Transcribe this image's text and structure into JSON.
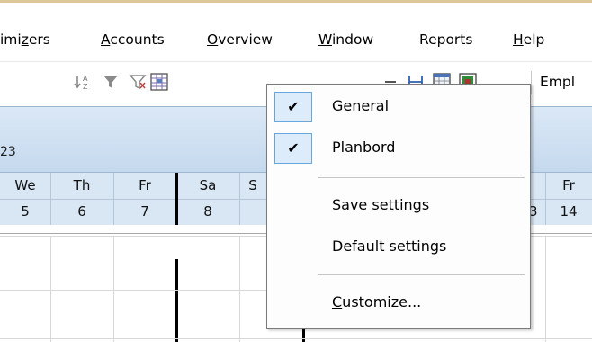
{
  "menubar": {
    "items": [
      {
        "pre": "imi",
        "u": "z",
        "post": "ers"
      },
      {
        "pre": "",
        "u": "A",
        "post": "ccounts"
      },
      {
        "pre": "",
        "u": "O",
        "post": "verview"
      },
      {
        "pre": "",
        "u": "W",
        "post": "indow"
      },
      {
        "pre": "Reports",
        "u": "",
        "post": ""
      },
      {
        "pre": "",
        "u": "H",
        "post": "elp"
      }
    ]
  },
  "toolbar": {
    "icons": [
      "sort-za-icon",
      "filter-icon",
      "filter-clear-icon",
      "layout-grid-icon",
      "minus-icon",
      "split-view-icon",
      "calendar-icon",
      "color-grid-icon"
    ],
    "employee_label": "Empl"
  },
  "dateband": {
    "label": "23"
  },
  "days": {
    "names": [
      "We",
      "Th",
      "Fr",
      "Sa",
      "S",
      "",
      "Fr"
    ],
    "numbers": [
      "5",
      "6",
      "7",
      "8",
      "",
      "3",
      "14"
    ]
  },
  "context_menu": {
    "items": [
      {
        "label": "General",
        "checked": true,
        "check_glyph": "✔"
      },
      {
        "label": "Planbord",
        "checked": true,
        "check_glyph": "✔"
      },
      {
        "label": "Save settings",
        "checked": false
      },
      {
        "label": "Default settings",
        "checked": false
      },
      {
        "label_u": "C",
        "label_rest": "ustomize...",
        "checked": false
      }
    ]
  },
  "colors": {
    "menu_border": "#7a7a7a",
    "check_bg": "#dcecfb",
    "check_border": "#67a7e0",
    "header_bg": "#d9e6f3",
    "today_line": "#000000"
  }
}
